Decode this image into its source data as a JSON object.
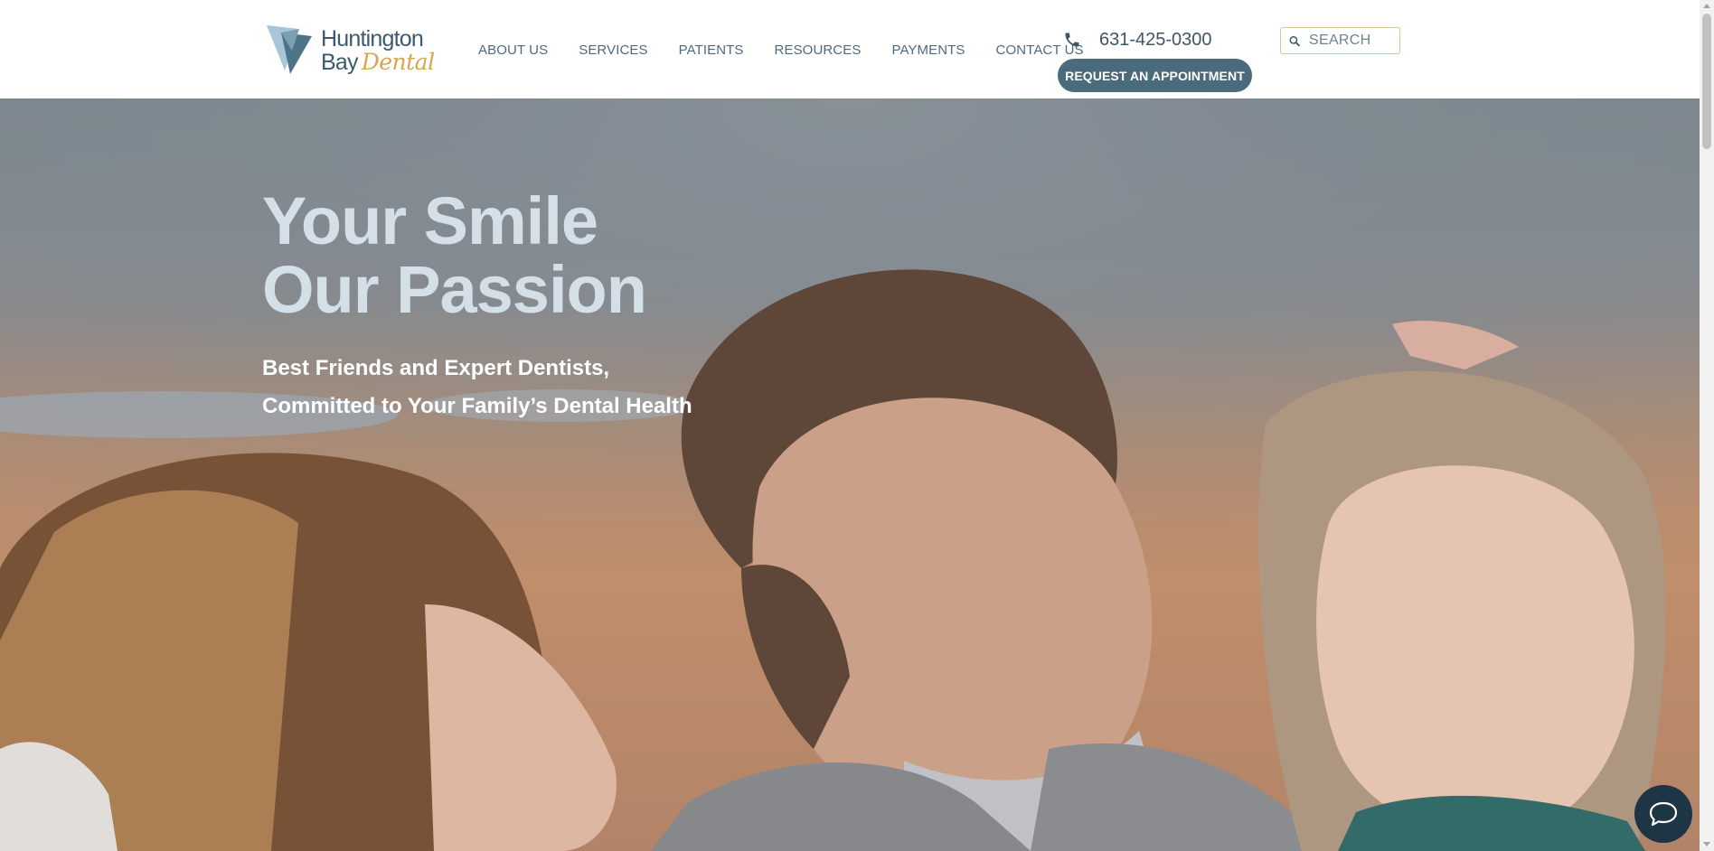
{
  "header": {
    "logo": {
      "line1": "Huntington",
      "line2": "Bay",
      "line2_script": "Dental",
      "icon": "tooth-logo-icon"
    },
    "nav": [
      {
        "label": "ABOUT US"
      },
      {
        "label": "SERVICES"
      },
      {
        "label": "PATIENTS"
      },
      {
        "label": "RESOURCES"
      },
      {
        "label": "PAYMENTS"
      },
      {
        "label": "CONTACT US"
      }
    ],
    "phone": {
      "icon": "phone-icon",
      "number": "631-425-0300"
    },
    "appointment_button": "REQUEST AN APPOINTMENT",
    "search": {
      "icon": "search-icon",
      "placeholder": "SEARCH",
      "value": ""
    }
  },
  "hero": {
    "title_line1": "Your Smile",
    "title_line2": "Our Passion",
    "subtitle_line1": "Best Friends and Expert Dentists,",
    "subtitle_line2": "Committed to Your Family’s Dental Health",
    "image": "family-smiling-photo"
  },
  "chat": {
    "icon": "chat-bubble-icon"
  },
  "colors": {
    "brand_slate": "#4a6b7c",
    "brand_gold": "#d7a64e",
    "nav_text": "#4e6a80",
    "hero_title": "#d4dfe8",
    "chat_button": "#1e3545"
  }
}
